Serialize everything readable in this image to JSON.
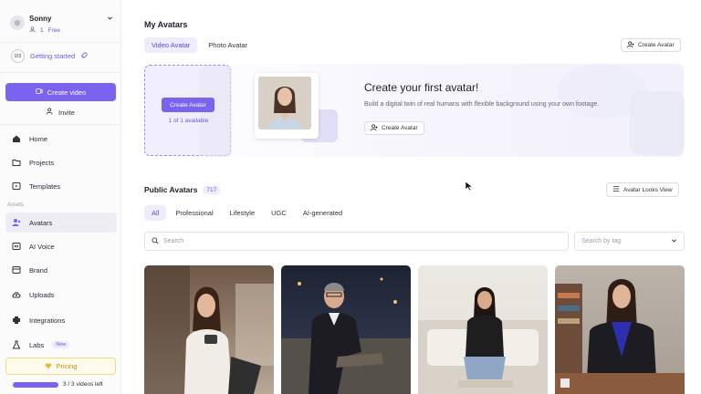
{
  "workspace": {
    "name": "Sonny",
    "members": "1",
    "plan": "Free"
  },
  "sidebar": {
    "getting_started": {
      "progress": "0/3",
      "label": "Getting started"
    },
    "create_video": "Create video",
    "invite": "Invite",
    "nav_top": [
      {
        "label": "Home",
        "icon": "home-icon"
      },
      {
        "label": "Projects",
        "icon": "folder-icon"
      },
      {
        "label": "Templates",
        "icon": "template-icon"
      }
    ],
    "section_label": "Assets",
    "nav_assets": [
      {
        "label": "Avatars",
        "icon": "avatar-icon",
        "active": true
      },
      {
        "label": "AI Voice",
        "icon": "voice-icon"
      },
      {
        "label": "Brand",
        "icon": "brand-icon"
      },
      {
        "label": "Uploads",
        "icon": "upload-icon"
      },
      {
        "label": "Integrations",
        "icon": "integrations-icon"
      },
      {
        "label": "Labs",
        "icon": "labs-icon",
        "badge": "New"
      }
    ],
    "pricing": "Pricing",
    "usage": {
      "label": "3 / 3 videos left",
      "fraction": 1.0
    }
  },
  "main": {
    "my_avatars_title": "My Avatars",
    "tabs": [
      {
        "label": "Video Avatar",
        "active": true
      },
      {
        "label": "Photo Avatar"
      }
    ],
    "create_avatar_top": "Create Avatar",
    "empty_card": {
      "button": "Create Avatar",
      "availability": "1 of 1 available"
    },
    "hero": {
      "title": "Create your first avatar!",
      "subtitle": "Build a digital twin of real humans with flexible background using your own footage.",
      "button": "Create Avatar"
    },
    "public": {
      "title": "Public Avatars",
      "count": "717",
      "looks_view": "Avatar Looks View",
      "filters": [
        "All",
        "Professional",
        "Lifestyle",
        "UGC",
        "AI-generated"
      ],
      "active_filter": "All",
      "search_placeholder": "Search",
      "tag_placeholder": "Search by tag"
    }
  },
  "colors": {
    "accent": "#7b63f0",
    "accent_light": "#efedfd",
    "pricing_gold": "#b8921e"
  }
}
